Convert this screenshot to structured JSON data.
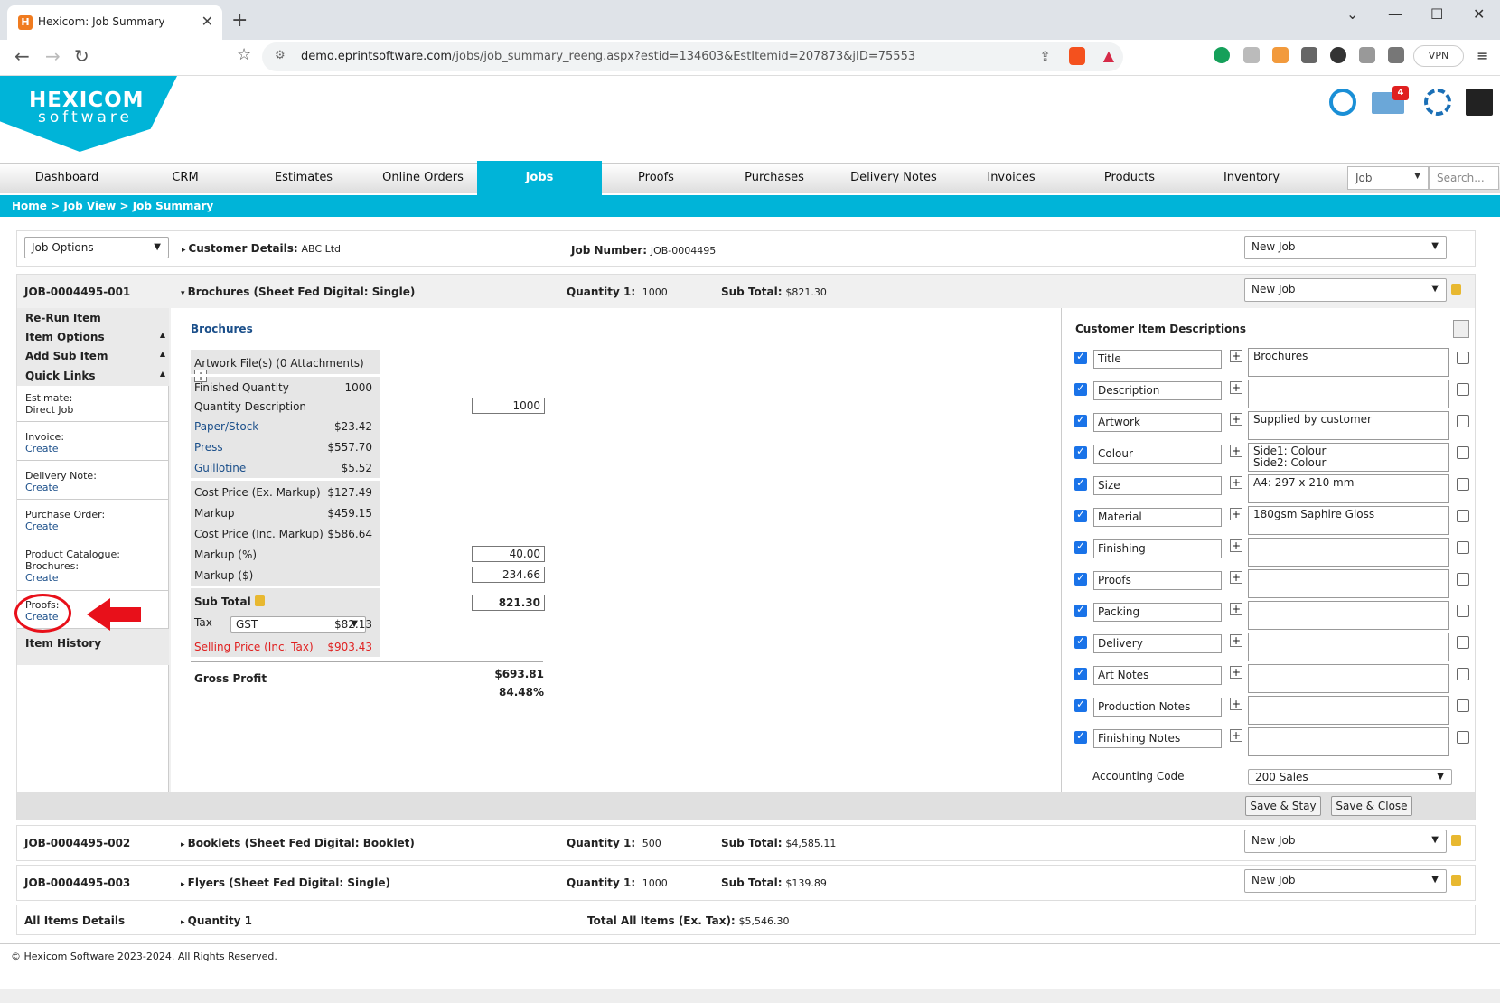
{
  "browser": {
    "tab_title": "Hexicom: Job Summary",
    "url_domain": "demo.eprintsoftware.com",
    "url_path": "/jobs/job_summary_reeng.aspx?estid=134603&EstItemid=207873&jID=75553",
    "vpn_label": "VPN"
  },
  "header": {
    "logo_line1": "HEXICOM",
    "logo_line2": "software",
    "mail_badge": "4"
  },
  "menu": {
    "items": [
      "Dashboard",
      "CRM",
      "Estimates",
      "Online Orders",
      "Jobs",
      "Proofs",
      "Purchases",
      "Delivery Notes",
      "Invoices",
      "Products",
      "Inventory"
    ],
    "active": "Jobs",
    "search_type": "Job",
    "search_placeholder": "Search..."
  },
  "breadcrumb": {
    "home": "Home",
    "job_view": "Job View",
    "current": "Job Summary",
    "sep": ">"
  },
  "job_header": {
    "options_label": "Job Options",
    "customer_label": "Customer Details:",
    "customer_value": "ABC Ltd",
    "job_number_label": "Job Number:",
    "job_number_value": "JOB-0004495",
    "status": "New Job"
  },
  "items": [
    {
      "id": "JOB-0004495-001",
      "name": "Brochures (Sheet Fed Digital: Single)",
      "qty_label": "Quantity 1:",
      "qty": "1000",
      "subtotal_label": "Sub Total:",
      "subtotal": "$821.30",
      "status": "New Job"
    },
    {
      "id": "JOB-0004495-002",
      "name": "Booklets (Sheet Fed Digital: Booklet)",
      "qty_label": "Quantity 1:",
      "qty": "500",
      "subtotal_label": "Sub Total:",
      "subtotal": "$4,585.11",
      "status": "New Job"
    },
    {
      "id": "JOB-0004495-003",
      "name": "Flyers (Sheet Fed Digital: Single)",
      "qty_label": "Quantity 1:",
      "qty": "1000",
      "subtotal_label": "Sub Total:",
      "subtotal": "$139.89",
      "status": "New Job"
    }
  ],
  "sidebar": {
    "rerun": "Re-Run Item",
    "item_options": "Item Options",
    "add_sub_item": "Add Sub Item",
    "quick_links": "Quick Links",
    "estimate_label": "Estimate:",
    "estimate_value": "Direct Job",
    "invoice_label": "Invoice:",
    "delivery_label": "Delivery Note:",
    "purchase_label": "Purchase Order:",
    "catalogue_label": "Product Catalogue:",
    "catalogue_value": "Brochures:",
    "proofs_label": "Proofs:",
    "create": "Create",
    "item_history": "Item History"
  },
  "calc": {
    "title": "Brochures",
    "artwork": "Artwork File(s) (0 Attachments)",
    "finished_qty_label": "Finished Quantity",
    "finished_qty": "1000",
    "qty_desc_label": "Quantity Description",
    "qty_desc": "1000",
    "paper_label": "Paper/Stock",
    "paper": "$23.42",
    "press_label": "Press",
    "press": "$557.70",
    "guillotine_label": "Guillotine",
    "guillotine": "$5.52",
    "cost_ex_label": "Cost Price (Ex. Markup)",
    "cost_ex": "$127.49",
    "markup_label": "Markup",
    "markup": "$459.15",
    "cost_inc_label": "Cost Price (Inc. Markup)",
    "cost_inc": "$586.64",
    "markup_pct_label": "Markup (%)",
    "markup_pct": "40.00",
    "markup_amt_label": "Markup ($)",
    "markup_amt": "234.66",
    "subtotal_label": "Sub Total",
    "subtotal": "821.30",
    "tax_label": "Tax",
    "tax_option": "GST",
    "tax": "$82.13",
    "selling_label": "Selling Price (Inc. Tax)",
    "selling": "$903.43",
    "gross_label": "Gross Profit",
    "gross": "$693.81",
    "gross_pct": "84.48%"
  },
  "descriptions": {
    "title": "Customer Item Descriptions",
    "rows": [
      {
        "label": "Title",
        "value": "Brochures"
      },
      {
        "label": "Description",
        "value": ""
      },
      {
        "label": "Artwork",
        "value": "Supplied by customer"
      },
      {
        "label": "Colour",
        "value": "Side1: Colour\nSide2: Colour"
      },
      {
        "label": "Size",
        "value": "A4: 297 x 210 mm"
      },
      {
        "label": "Material",
        "value": "180gsm Saphire Gloss"
      },
      {
        "label": "Finishing",
        "value": ""
      },
      {
        "label": "Proofs",
        "value": ""
      },
      {
        "label": "Packing",
        "value": ""
      },
      {
        "label": "Delivery",
        "value": ""
      },
      {
        "label": "Art Notes",
        "value": ""
      },
      {
        "label": "Production Notes",
        "value": ""
      },
      {
        "label": "Finishing Notes",
        "value": ""
      }
    ],
    "accounting_label": "Accounting Code",
    "accounting_value": "200 Sales",
    "save_stay": "Save & Stay",
    "save_close": "Save & Close"
  },
  "totals": {
    "label": "All Items Details",
    "qty_label": "Quantity 1",
    "total_label": "Total All Items (Ex. Tax):",
    "total_value": "$5,546.30"
  },
  "footer": "© Hexicom Software 2023-2024. All Rights Reserved.",
  "colors": {
    "accent": "#00b4d8",
    "link": "#1b4f8a",
    "annotation": "#e8101a"
  }
}
